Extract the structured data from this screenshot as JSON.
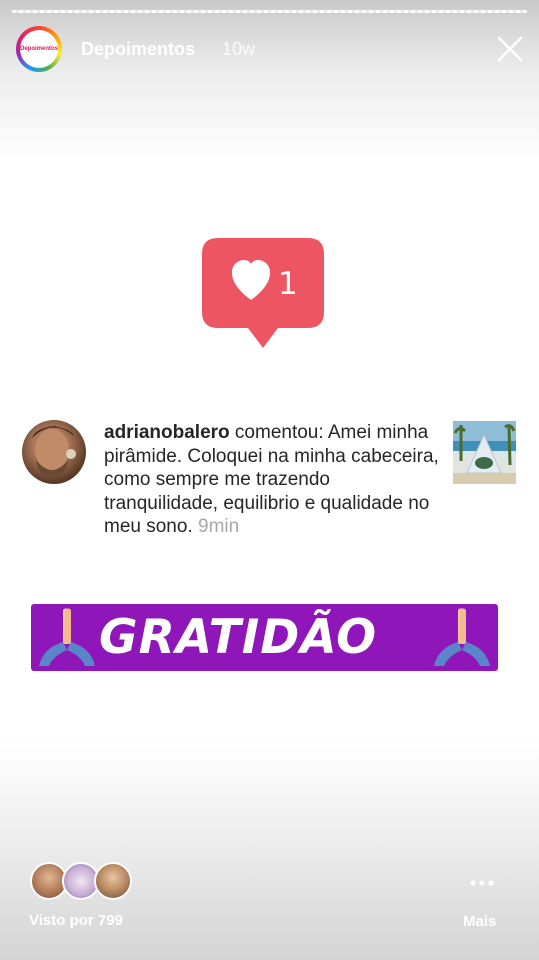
{
  "story": {
    "progress": 1.0
  },
  "header": {
    "account_name": "Depoimentos",
    "posted_ago": "10w",
    "avatar_logo_text": "Depoimentos",
    "close_icon": "close-icon"
  },
  "notification": {
    "icon": "heart-icon",
    "count": "1",
    "color": "#ee5562"
  },
  "comment": {
    "username": "adrianobalero",
    "body": " comentou: Amei minha pirâmide.  Coloquei na minha cabeceira, como sempre me trazendo tranquilidade, equilibrio e qualidade no meu sono. ",
    "time": "9min"
  },
  "banner": {
    "text": "GRATIDÃO",
    "color": "#8f16b8",
    "icon": "praying-hands-icon"
  },
  "footer": {
    "seen_by": "Visto por 799",
    "more_label": "Mais",
    "more_icon": "more-dots-icon"
  }
}
